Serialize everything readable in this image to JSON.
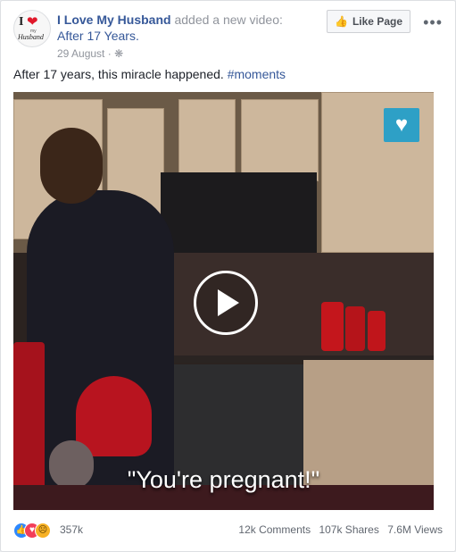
{
  "post": {
    "page_name": "I Love My Husband",
    "action": "added a new video:",
    "video_title": "After 17 Years.",
    "date": "29 August",
    "meta_sep": "·",
    "privacy_icon": "globe-icon",
    "like_button": "Like Page",
    "more_icon": "•••",
    "caption_text": "After 17 years, this miracle happened.",
    "caption_tag": "#moments"
  },
  "avatar": {
    "line1": "I",
    "line2": "my",
    "line3": "Husband"
  },
  "video": {
    "subtitle": "\"You're pregnant!\"",
    "play_icon": "play-icon",
    "badge_icon": "heart-house-icon"
  },
  "footer": {
    "reactions_count": "357k",
    "comments": "12k Comments",
    "shares": "107k Shares",
    "views": "7.6M Views"
  },
  "colors": {
    "link": "#365899",
    "secondary": "#90949c",
    "like": "#2d88ff",
    "love": "#f33e58",
    "sad": "#f7b125",
    "badge": "#2ea0c6"
  }
}
